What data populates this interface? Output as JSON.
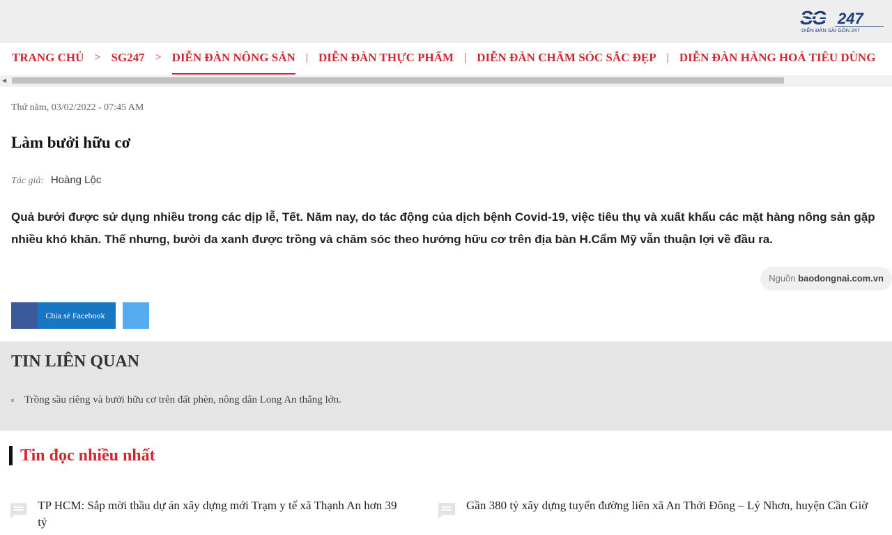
{
  "header": {
    "logo_text": "SG247",
    "logo_tagline": "DIỄN ĐÀN SÀI GÒN 247"
  },
  "nav": {
    "items": [
      {
        "label": "TRANG CHỦ"
      },
      {
        "label": "SG247"
      },
      {
        "label": "DIỄN ĐÀN NÔNG SẢN"
      },
      {
        "label": "DIỄN ĐÀN THỰC PHẨM"
      },
      {
        "label": "DIỄN ĐÀN CHĂM SÓC SẮC ĐẸP"
      },
      {
        "label": "DIỄN ĐÀN HÀNG HOÁ TIÊU DÙNG"
      }
    ],
    "sep_breadcrumb": ">",
    "sep_pipe": "|"
  },
  "article": {
    "date": "Thứ năm, 03/02/2022 - 07:45 AM",
    "title": "Làm bưởi hữu cơ",
    "author_label": "Tác giả:",
    "author_name": "Hoàng Lộc",
    "lead": "Quả bưởi được sử dụng nhiều trong các dịp lễ, Tết. Năm nay, do tác động của dịch bệnh Covid-19, việc tiêu thụ và xuất khẩu các mặt hàng nông sản gặp nhiều khó khăn. Thế nhưng, bưởi da xanh được trồng và chăm sóc theo hướng hữu cơ trên địa bàn H.Cẩm Mỹ vẫn thuận lợi về đầu ra.",
    "source_label": "Nguồn",
    "source_name": "baodongnai.com.vn"
  },
  "share": {
    "facebook_label": "Chia sẻ Facebook"
  },
  "related": {
    "title": "TIN LIÊN QUAN",
    "items": [
      {
        "text": "Trồng sầu riêng và bưởi hữu cơ trên đất phèn, nông dân Long An thắng lớn."
      }
    ]
  },
  "most_read": {
    "title": "Tin đọc nhiều nhất",
    "items": [
      {
        "text": "TP HCM: Sắp mời thầu dự án xây dựng mới Trạm y tế xã Thạnh An hơn 39 tỷ"
      },
      {
        "text": "Gần 380 tỷ xây dựng tuyến đường liên xã An Thới Đông – Lý Nhơn, huyện Cần Giờ"
      }
    ]
  },
  "colors": {
    "brand_red": "#d0262f",
    "facebook_blue": "#1877c2",
    "twitter_blue": "#55acee"
  }
}
